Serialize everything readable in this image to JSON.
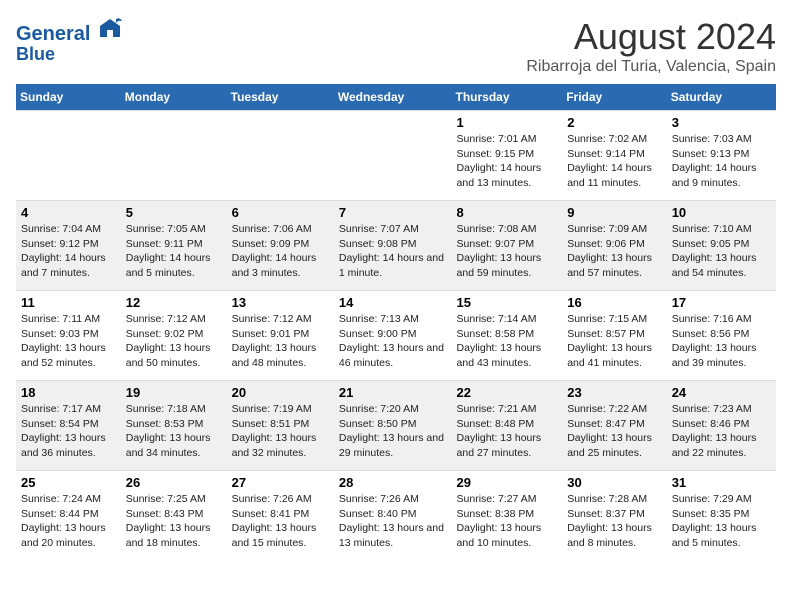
{
  "header": {
    "logo_line1": "General",
    "logo_line2": "Blue",
    "title": "August 2024",
    "subtitle": "Ribarroja del Turia, Valencia, Spain"
  },
  "days_of_week": [
    "Sunday",
    "Monday",
    "Tuesday",
    "Wednesday",
    "Thursday",
    "Friday",
    "Saturday"
  ],
  "weeks": [
    [
      {
        "day": "",
        "sunrise": "",
        "sunset": "",
        "daylight": ""
      },
      {
        "day": "",
        "sunrise": "",
        "sunset": "",
        "daylight": ""
      },
      {
        "day": "",
        "sunrise": "",
        "sunset": "",
        "daylight": ""
      },
      {
        "day": "",
        "sunrise": "",
        "sunset": "",
        "daylight": ""
      },
      {
        "day": "1",
        "sunrise": "Sunrise: 7:01 AM",
        "sunset": "Sunset: 9:15 PM",
        "daylight": "Daylight: 14 hours and 13 minutes."
      },
      {
        "day": "2",
        "sunrise": "Sunrise: 7:02 AM",
        "sunset": "Sunset: 9:14 PM",
        "daylight": "Daylight: 14 hours and 11 minutes."
      },
      {
        "day": "3",
        "sunrise": "Sunrise: 7:03 AM",
        "sunset": "Sunset: 9:13 PM",
        "daylight": "Daylight: 14 hours and 9 minutes."
      }
    ],
    [
      {
        "day": "4",
        "sunrise": "Sunrise: 7:04 AM",
        "sunset": "Sunset: 9:12 PM",
        "daylight": "Daylight: 14 hours and 7 minutes."
      },
      {
        "day": "5",
        "sunrise": "Sunrise: 7:05 AM",
        "sunset": "Sunset: 9:11 PM",
        "daylight": "Daylight: 14 hours and 5 minutes."
      },
      {
        "day": "6",
        "sunrise": "Sunrise: 7:06 AM",
        "sunset": "Sunset: 9:09 PM",
        "daylight": "Daylight: 14 hours and 3 minutes."
      },
      {
        "day": "7",
        "sunrise": "Sunrise: 7:07 AM",
        "sunset": "Sunset: 9:08 PM",
        "daylight": "Daylight: 14 hours and 1 minute."
      },
      {
        "day": "8",
        "sunrise": "Sunrise: 7:08 AM",
        "sunset": "Sunset: 9:07 PM",
        "daylight": "Daylight: 13 hours and 59 minutes."
      },
      {
        "day": "9",
        "sunrise": "Sunrise: 7:09 AM",
        "sunset": "Sunset: 9:06 PM",
        "daylight": "Daylight: 13 hours and 57 minutes."
      },
      {
        "day": "10",
        "sunrise": "Sunrise: 7:10 AM",
        "sunset": "Sunset: 9:05 PM",
        "daylight": "Daylight: 13 hours and 54 minutes."
      }
    ],
    [
      {
        "day": "11",
        "sunrise": "Sunrise: 7:11 AM",
        "sunset": "Sunset: 9:03 PM",
        "daylight": "Daylight: 13 hours and 52 minutes."
      },
      {
        "day": "12",
        "sunrise": "Sunrise: 7:12 AM",
        "sunset": "Sunset: 9:02 PM",
        "daylight": "Daylight: 13 hours and 50 minutes."
      },
      {
        "day": "13",
        "sunrise": "Sunrise: 7:12 AM",
        "sunset": "Sunset: 9:01 PM",
        "daylight": "Daylight: 13 hours and 48 minutes."
      },
      {
        "day": "14",
        "sunrise": "Sunrise: 7:13 AM",
        "sunset": "Sunset: 9:00 PM",
        "daylight": "Daylight: 13 hours and 46 minutes."
      },
      {
        "day": "15",
        "sunrise": "Sunrise: 7:14 AM",
        "sunset": "Sunset: 8:58 PM",
        "daylight": "Daylight: 13 hours and 43 minutes."
      },
      {
        "day": "16",
        "sunrise": "Sunrise: 7:15 AM",
        "sunset": "Sunset: 8:57 PM",
        "daylight": "Daylight: 13 hours and 41 minutes."
      },
      {
        "day": "17",
        "sunrise": "Sunrise: 7:16 AM",
        "sunset": "Sunset: 8:56 PM",
        "daylight": "Daylight: 13 hours and 39 minutes."
      }
    ],
    [
      {
        "day": "18",
        "sunrise": "Sunrise: 7:17 AM",
        "sunset": "Sunset: 8:54 PM",
        "daylight": "Daylight: 13 hours and 36 minutes."
      },
      {
        "day": "19",
        "sunrise": "Sunrise: 7:18 AM",
        "sunset": "Sunset: 8:53 PM",
        "daylight": "Daylight: 13 hours and 34 minutes."
      },
      {
        "day": "20",
        "sunrise": "Sunrise: 7:19 AM",
        "sunset": "Sunset: 8:51 PM",
        "daylight": "Daylight: 13 hours and 32 minutes."
      },
      {
        "day": "21",
        "sunrise": "Sunrise: 7:20 AM",
        "sunset": "Sunset: 8:50 PM",
        "daylight": "Daylight: 13 hours and 29 minutes."
      },
      {
        "day": "22",
        "sunrise": "Sunrise: 7:21 AM",
        "sunset": "Sunset: 8:48 PM",
        "daylight": "Daylight: 13 hours and 27 minutes."
      },
      {
        "day": "23",
        "sunrise": "Sunrise: 7:22 AM",
        "sunset": "Sunset: 8:47 PM",
        "daylight": "Daylight: 13 hours and 25 minutes."
      },
      {
        "day": "24",
        "sunrise": "Sunrise: 7:23 AM",
        "sunset": "Sunset: 8:46 PM",
        "daylight": "Daylight: 13 hours and 22 minutes."
      }
    ],
    [
      {
        "day": "25",
        "sunrise": "Sunrise: 7:24 AM",
        "sunset": "Sunset: 8:44 PM",
        "daylight": "Daylight: 13 hours and 20 minutes."
      },
      {
        "day": "26",
        "sunrise": "Sunrise: 7:25 AM",
        "sunset": "Sunset: 8:43 PM",
        "daylight": "Daylight: 13 hours and 18 minutes."
      },
      {
        "day": "27",
        "sunrise": "Sunrise: 7:26 AM",
        "sunset": "Sunset: 8:41 PM",
        "daylight": "Daylight: 13 hours and 15 minutes."
      },
      {
        "day": "28",
        "sunrise": "Sunrise: 7:26 AM",
        "sunset": "Sunset: 8:40 PM",
        "daylight": "Daylight: 13 hours and 13 minutes."
      },
      {
        "day": "29",
        "sunrise": "Sunrise: 7:27 AM",
        "sunset": "Sunset: 8:38 PM",
        "daylight": "Daylight: 13 hours and 10 minutes."
      },
      {
        "day": "30",
        "sunrise": "Sunrise: 7:28 AM",
        "sunset": "Sunset: 8:37 PM",
        "daylight": "Daylight: 13 hours and 8 minutes."
      },
      {
        "day": "31",
        "sunrise": "Sunrise: 7:29 AM",
        "sunset": "Sunset: 8:35 PM",
        "daylight": "Daylight: 13 hours and 5 minutes."
      }
    ]
  ]
}
